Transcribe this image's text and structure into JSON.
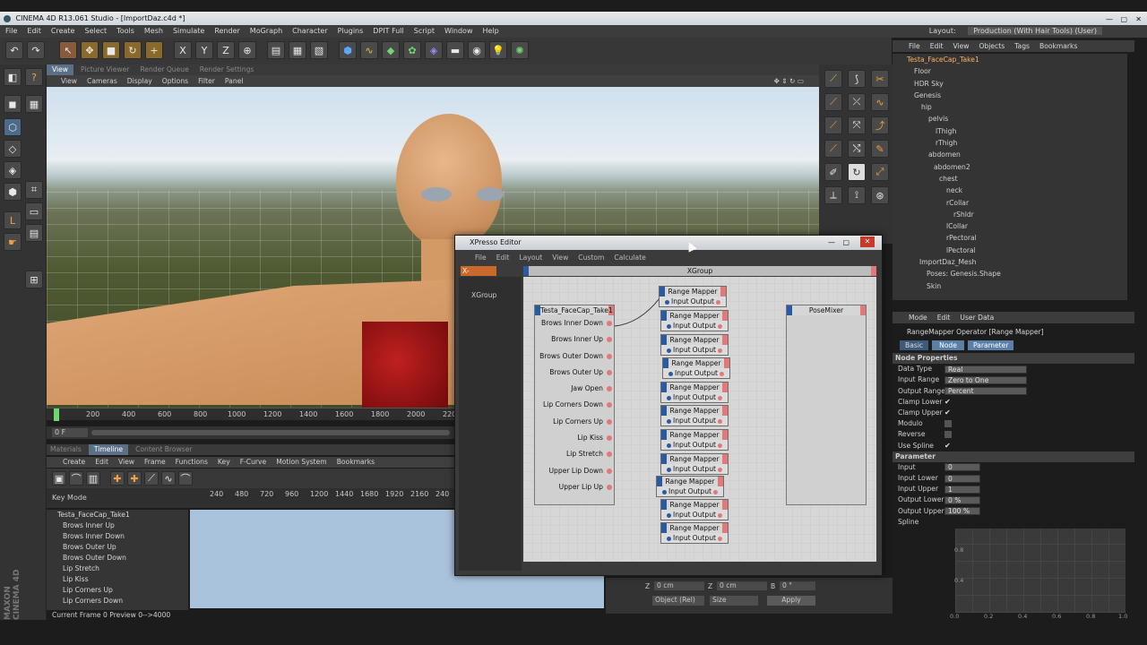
{
  "titlebar": {
    "title": "CINEMA 4D R13.061 Studio - [ImportDaz.c4d *]"
  },
  "menubar": {
    "items": [
      "File",
      "Edit",
      "Create",
      "Select",
      "Tools",
      "Mesh",
      "Simulate",
      "Render",
      "MoGraph",
      "Character",
      "Plugins",
      "DPIT Full",
      "Script",
      "Window",
      "Help"
    ],
    "layout_label": "Layout:",
    "layout_value": "Production (With Hair Tools) (User)"
  },
  "viewport_tabs": [
    "View",
    "Picture Viewer",
    "Render Queue",
    "Render Settings"
  ],
  "viewport_menu": [
    "View",
    "Cameras",
    "Display",
    "Options",
    "Filter",
    "Panel"
  ],
  "ruler": {
    "ticks": [
      "200",
      "400",
      "600",
      "800",
      "1000",
      "1200",
      "1400",
      "1600",
      "1800",
      "2000",
      "220"
    ],
    "frame_field": "0 F"
  },
  "timeline": {
    "tabs": [
      "Materials",
      "Timeline",
      "Content Browser"
    ],
    "menu": [
      "Create",
      "Edit",
      "View",
      "Frame",
      "Functions",
      "Key",
      "F-Curve",
      "Motion System",
      "Bookmarks"
    ],
    "mode": "Key Mode",
    "ticks": [
      "240",
      "480",
      "720",
      "960",
      "1200",
      "1440",
      "1680",
      "1920",
      "2160",
      "240"
    ],
    "tracks": [
      "Testa_FaceCap_Take1",
      "Brows Inner Up",
      "Brows Inner Down",
      "Brows Outer Up",
      "Brows Outer Down",
      "Lip Stretch",
      "Lip Kiss",
      "Lip Corners Up",
      "Lip Corners Down"
    ],
    "status": "Current Frame  0  Preview  0-->4000"
  },
  "objects": {
    "menu": [
      "File",
      "Edit",
      "View",
      "Objects",
      "Tags",
      "Bookmarks"
    ],
    "tree": [
      "Testa_FaceCap_Take1",
      "Floor",
      "HDR Sky",
      "Genesis",
      "hip",
      "pelvis",
      "lThigh",
      "rThigh",
      "abdomen",
      "abdomen2",
      "chest",
      "neck",
      "rCollar",
      "rShldr",
      "lCollar",
      "rPectoral",
      "lPectoral",
      "ImportDaz_Mesh",
      "Poses: Genesis.Shape",
      "Skin"
    ]
  },
  "attributes": {
    "menu": [
      "Mode",
      "Edit",
      "User Data"
    ],
    "object_title": "RangeMapper Operator [Range Mapper]",
    "tabs": [
      "Basic",
      "Node",
      "Parameter"
    ],
    "node_section": "Node Properties",
    "data_type_label": "Data Type",
    "data_type": "Real",
    "input_range_label": "Input Range",
    "input_range": "Zero to One",
    "output_range_label": "Output Range",
    "output_range": "Percent",
    "clamp_lower_label": "Clamp Lower",
    "clamp_upper_label": "Clamp Upper",
    "modulo_label": "Modulo",
    "reverse_label": "Reverse",
    "use_spline_label": "Use Spline",
    "param_section": "Parameter",
    "input_label": "Input",
    "input": "0",
    "input_lower_label": "Input Lower",
    "input_lower": "0",
    "input_upper_label": "Input Upper",
    "input_upper": "1",
    "output_lower_label": "Output Lower",
    "output_lower": "0 %",
    "output_upper_label": "Output Upper",
    "output_upper": "100 %",
    "spline_label": "Spline",
    "spline_y": [
      "0.8",
      "0.4"
    ],
    "spline_x": [
      "0.0",
      "0.2",
      "0.4",
      "0.6",
      "0.8",
      "1.0"
    ]
  },
  "coords": {
    "z1": "0 cm",
    "z2": "0 cm",
    "b": "0 °",
    "mode": "Object (Rel)",
    "size": "Size",
    "apply": "Apply"
  },
  "xpresso": {
    "title": "XPresso Editor",
    "menu": [
      "File",
      "Edit",
      "Layout",
      "View",
      "Custom",
      "Calculate"
    ],
    "manager_tab": "X-Manager",
    "group_header": "XGroup",
    "tree_item": "XGroup",
    "source_node": "Testa_FaceCap_Take1",
    "outputs": [
      "Brows Inner Down",
      "Brows Inner Up",
      "Brows Outer Down",
      "Brows Outer Up",
      "Jaw Open",
      "Lip Corners Down",
      "Lip Corners Up",
      "Lip Kiss",
      "Lip Stretch",
      "Upper Lip Down",
      "Upper Lip Up"
    ],
    "mapper_title": "Range Mapper",
    "mapper_in": "Input",
    "mapper_out": "Output",
    "target_node": "PoseMixer"
  },
  "logo": "MAXON CINEMA 4D"
}
